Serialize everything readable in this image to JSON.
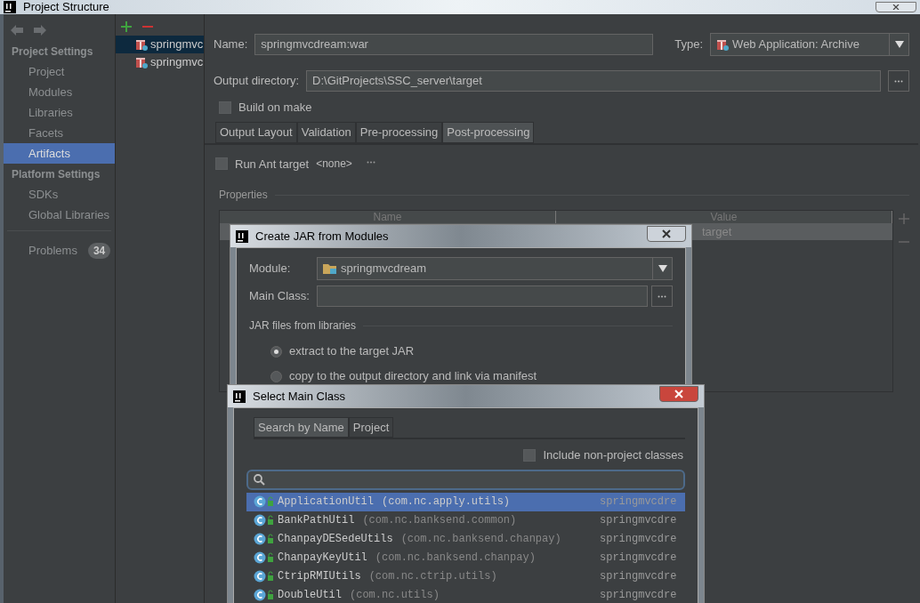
{
  "window": {
    "title": "Project Structure"
  },
  "sidebar": {
    "sections": [
      {
        "heading": "Project Settings",
        "items": [
          {
            "label": "Project",
            "selected": false
          },
          {
            "label": "Modules",
            "selected": false
          },
          {
            "label": "Libraries",
            "selected": false
          },
          {
            "label": "Facets",
            "selected": false
          },
          {
            "label": "Artifacts",
            "selected": true
          }
        ]
      },
      {
        "heading": "Platform Settings",
        "items": [
          {
            "label": "SDKs",
            "selected": false
          },
          {
            "label": "Global Libraries",
            "selected": false
          }
        ]
      }
    ],
    "problems": {
      "label": "Problems",
      "count": "34"
    }
  },
  "artifacts": [
    {
      "label": "springmvc",
      "selected": true
    },
    {
      "label": "springmvc",
      "selected": false
    }
  ],
  "form": {
    "name_label": "Name:",
    "name_value": "springmvcdream:war",
    "type_label": "Type:",
    "type_value": "Web Application: Archive",
    "output_label": "Output directory:",
    "output_value": "D:\\GitProjects\\SSC_server\\target",
    "build_on_make": {
      "label": "Build on make",
      "checked": false
    }
  },
  "tabs": [
    {
      "label": "Output Layout",
      "selected": false
    },
    {
      "label": "Validation",
      "selected": false
    },
    {
      "label": "Pre-processing",
      "selected": false
    },
    {
      "label": "Post-processing",
      "selected": true
    }
  ],
  "run_ant": {
    "label": "Run Ant target",
    "target": "<none>",
    "checked": false
  },
  "properties": {
    "title": "Properties",
    "columns": [
      "Name",
      "Value"
    ],
    "rows": [
      {
        "value": "target"
      }
    ]
  },
  "create_jar": {
    "title": "Create JAR from Modules",
    "module_label": "Module:",
    "module_value": "springmvcdream",
    "main_class_label": "Main Class:",
    "libraries_title": "JAR files from libraries",
    "options": [
      {
        "label": "extract to the target JAR",
        "selected": true
      },
      {
        "label": "copy to the output directory and link via manifest",
        "selected": false
      }
    ]
  },
  "select_main_class": {
    "title": "Select Main Class",
    "tabs": [
      {
        "label": "Search by Name",
        "selected": true
      },
      {
        "label": "Project",
        "selected": false
      }
    ],
    "include": {
      "label": "Include non-project classes",
      "checked": false
    },
    "results": [
      {
        "name": "ApplicationUtil",
        "package": "(com.nc.apply.utils)",
        "module": "springmvcdre",
        "selected": true
      },
      {
        "name": "BankPathUtil",
        "package": "(com.nc.banksend.common)",
        "module": "springmvcdre",
        "selected": false
      },
      {
        "name": "ChanpayDESedeUtils",
        "package": "(com.nc.banksend.chanpay)",
        "module": "springmvcdre",
        "selected": false
      },
      {
        "name": "ChanpayKeyUtil",
        "package": "(com.nc.banksend.chanpay)",
        "module": "springmvcdre",
        "selected": false
      },
      {
        "name": "CtripRMIUtils",
        "package": "(com.nc.ctrip.utils)",
        "module": "springmvcdre",
        "selected": false
      },
      {
        "name": "DoubleUtil",
        "package": "(com.nc.utils)",
        "module": "springmvcdre",
        "selected": false
      }
    ]
  }
}
